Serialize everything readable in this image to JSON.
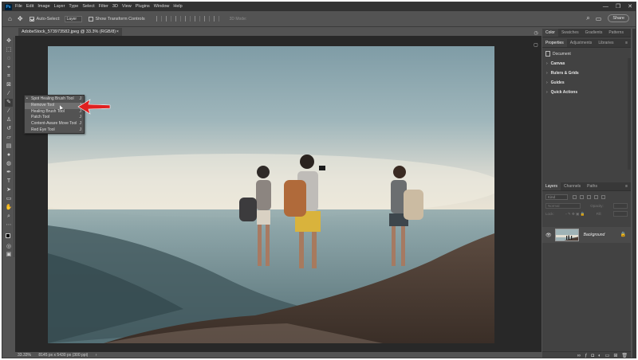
{
  "menubar": {
    "logo": "Ps",
    "items": [
      "File",
      "Edit",
      "Image",
      "Layer",
      "Type",
      "Select",
      "Filter",
      "3D",
      "View",
      "Plugins",
      "Window",
      "Help"
    ],
    "window_controls": [
      "—",
      "❐",
      "✕"
    ]
  },
  "options": {
    "auto_select_label": "Auto-Select:",
    "auto_select_checked": true,
    "auto_select_value": "Layer",
    "transform_label": "Show Transform Controls",
    "transform_checked": false,
    "mode_3d_label": "3D Mode:",
    "share_label": "Share"
  },
  "document": {
    "tab_title": "AdobeStock_573973582.jpeg @ 33.3% (RGB/8)",
    "close_glyph": "×"
  },
  "tool_flyout": {
    "items": [
      {
        "label": "Spot Healing Brush Tool",
        "key": "J",
        "active": true,
        "highlighted": false
      },
      {
        "label": "Remove Tool",
        "key": "J",
        "active": false,
        "highlighted": true
      },
      {
        "label": "Healing Brush Tool",
        "key": "J",
        "active": false,
        "highlighted": false
      },
      {
        "label": "Patch Tool",
        "key": "J",
        "active": false,
        "highlighted": false
      },
      {
        "label": "Content-Aware Move Tool",
        "key": "J",
        "active": false,
        "highlighted": false
      },
      {
        "label": "Red Eye Tool",
        "key": "J",
        "active": false,
        "highlighted": false
      }
    ]
  },
  "status": {
    "zoom": "33.33%",
    "dimensions": "8145 px x 5430 px (300 ppi)",
    "arrow": "›"
  },
  "color_panel": {
    "tabs": [
      "Color",
      "Swatches",
      "Gradients",
      "Patterns"
    ],
    "active": "Color"
  },
  "properties_panel": {
    "tabs": [
      "Properties",
      "Adjustments",
      "Libraries"
    ],
    "active": "Properties",
    "document_label": "Document",
    "sections": [
      "Canvas",
      "Rulers & Grids",
      "Guides",
      "Quick Actions"
    ]
  },
  "layers_panel": {
    "tabs": [
      "Layers",
      "Channels",
      "Paths"
    ],
    "active": "Layers",
    "kind_placeholder": "Kind",
    "blend_mode": "Normal",
    "opacity_label": "Opacity:",
    "opacity_value": "",
    "lock_label": "Lock:",
    "fill_label": "Fill:",
    "fill_value": "",
    "layer_name": "Background"
  },
  "colors": {
    "app_bg": "#535353",
    "panel_bg": "#424242",
    "canvas_bg": "#282828",
    "arrow_red": "#e02020"
  }
}
